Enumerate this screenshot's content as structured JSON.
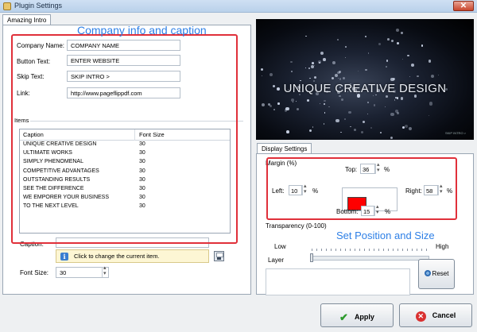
{
  "window": {
    "title": "Plugin Settings",
    "close_glyph": "✕"
  },
  "tabs": {
    "intro": "Amazing Intro",
    "display": "Display Settings"
  },
  "annotations": {
    "company": "Company info and caption",
    "position": "Set Position and Size"
  },
  "company": {
    "name_label": "Company Name:",
    "name_value": "COMPANY NAME",
    "button_label": "Button Text:",
    "button_value": "ENTER WEBSITE",
    "skip_label": "Skip Text:",
    "skip_value": "SKIP INTRO >",
    "link_label": "Link:",
    "link_value": "http://www.pageflippdf.com"
  },
  "items": {
    "group_title": "Items",
    "headers": {
      "caption": "Caption",
      "font_size": "Font Size"
    },
    "rows": [
      {
        "caption": "UNIQUE CREATIVE DESIGN",
        "size": "30"
      },
      {
        "caption": "ULTIMATE WORKS",
        "size": "30"
      },
      {
        "caption": "SIMPLY PHENOMENAL",
        "size": "30"
      },
      {
        "caption": "COMPETITIVE  ADVANTAGES",
        "size": "30"
      },
      {
        "caption": "OUTSTANDING RESULTS",
        "size": "30"
      },
      {
        "caption": "SEE THE DIFFERENCE",
        "size": "30"
      },
      {
        "caption": "WE EMPORER YOUR BUSINESS",
        "size": "30"
      },
      {
        "caption": "TO THE NEXT LEVEL",
        "size": "30"
      }
    ]
  },
  "caption_editor": {
    "caption_label": "Caption:",
    "caption_value": "",
    "hint": "Click to change the current item.",
    "font_size_label": "Font Size:",
    "font_size_value": "30"
  },
  "preview": {
    "headline": "UNIQUE CREATIVE DESIGN",
    "skip_small": "SKIP INTRO >"
  },
  "display": {
    "margin_title": "Margin (%)",
    "top_label": "Top:",
    "top_value": "36",
    "left_label": "Left:",
    "left_value": "10",
    "right_label": "Right:",
    "right_value": "58",
    "bottom_label": "Bottom:",
    "bottom_value": "15",
    "percent": "%",
    "swatch_color": "#ff0000",
    "transparency_title": "Transparency (0-100)",
    "transparency_value": 0,
    "low_label": "Low",
    "high_label": "High",
    "layer_title": "Layer",
    "reset_label": "Reset"
  },
  "footer": {
    "apply_label": "Apply",
    "cancel_label": "Cancel"
  }
}
